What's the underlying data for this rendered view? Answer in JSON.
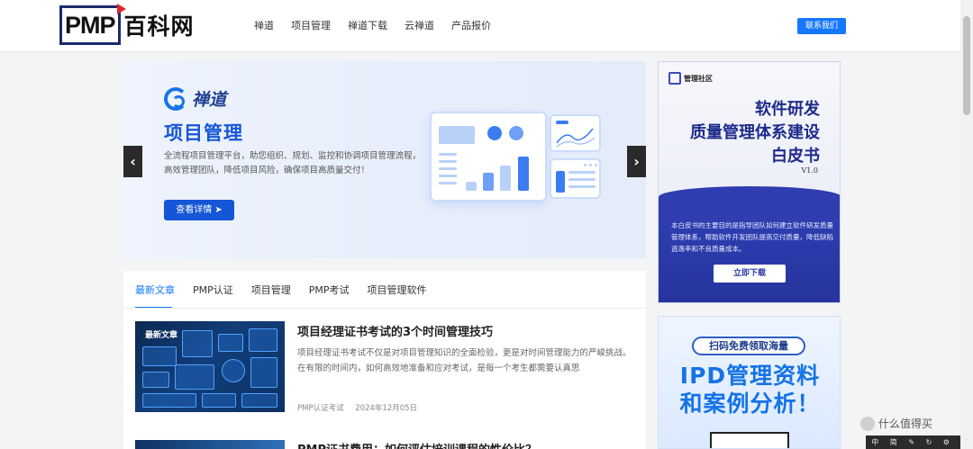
{
  "header": {
    "logo_pmp": "PMP",
    "logo_cn": "百科网",
    "nav": [
      "禅道",
      "项目管理",
      "禅道下载",
      "云禅道",
      "产品报价"
    ],
    "contact_label": "联系我们"
  },
  "banner": {
    "brand": "禅道",
    "title": "项目管理",
    "desc": "全流程项目管理平台，助您组织、规划、监控和协调项目管理流程，高效管理团队，降低项目风险，确保项目高质量交付！",
    "button": "查看详情 ➤",
    "prev": "‹",
    "next": "›"
  },
  "articles": {
    "tabs": [
      "最新文章",
      "PMP认证",
      "项目管理",
      "PMP考试",
      "项目管理软件"
    ],
    "post1": {
      "thumb_label": "最新文章",
      "title": "项目经理证书考试的3个时间管理技巧",
      "excerpt": "项目经理证书考试不仅是对项目管理知识的全面检验，更是对时间管理能力的严峻挑战。在有限的时间内，如何高效地准备和应对考试，是每一个考生都需要认真思",
      "category": "PMP认证考试",
      "date": "2024年12月05日"
    },
    "post2": {
      "title": "PMP证书费用：如何评估培训课程的性价比？"
    }
  },
  "ad1": {
    "logo": "管理社区",
    "title_line1": "软件研发",
    "title_line2": "质量管理体系建设",
    "title_line3": "白皮书",
    "version": "V1.0",
    "desc": "本白皮书的主要目的是指导团队如何建立软件研发质量管理体系，帮助软件开发团队提高交付质量，降低缺陷逃逸率和不良质量成本。",
    "button": "立即下载"
  },
  "ad2": {
    "pill": "扫码免费领取海量",
    "line1": "IPD管理资料",
    "line2": "和案例分析！"
  },
  "watermark": "什么值得买",
  "toolbar": [
    "中",
    "简",
    "✎",
    "↻",
    "⚙",
    "☰"
  ]
}
